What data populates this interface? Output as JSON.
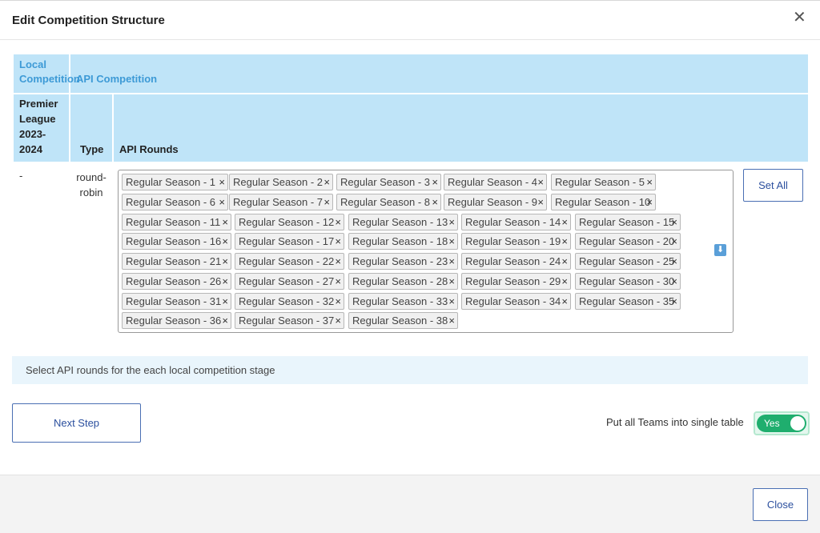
{
  "modal": {
    "title": "Edit Competition Structure"
  },
  "table": {
    "header_local": "Local Competition",
    "header_api": "API Competition",
    "sub_local": "Premier League 2023-2024",
    "sub_type": "Type",
    "sub_rounds": "API Rounds",
    "row": {
      "local": "-",
      "type": "round-robin"
    },
    "rounds": [
      "Regular Season - 1",
      "Regular Season - 2",
      "Regular Season - 3",
      "Regular Season - 4",
      "Regular Season - 5",
      "Regular Season - 6",
      "Regular Season - 7",
      "Regular Season - 8",
      "Regular Season - 9",
      "Regular Season - 10",
      "Regular Season - 11",
      "Regular Season - 12",
      "Regular Season - 13",
      "Regular Season - 14",
      "Regular Season - 15",
      "Regular Season - 16",
      "Regular Season - 17",
      "Regular Season - 18",
      "Regular Season - 19",
      "Regular Season - 20",
      "Regular Season - 21",
      "Regular Season - 22",
      "Regular Season - 23",
      "Regular Season - 24",
      "Regular Season - 25",
      "Regular Season - 26",
      "Regular Season - 27",
      "Regular Season - 28",
      "Regular Season - 29",
      "Regular Season - 30",
      "Regular Season - 31",
      "Regular Season - 32",
      "Regular Season - 33",
      "Regular Season - 34",
      "Regular Season - 35",
      "Regular Season - 36",
      "Regular Season - 37",
      "Regular Season - 38"
    ],
    "tag_remove_glyph": "×",
    "set_all_label": "Set All"
  },
  "info": {
    "text": "Select API rounds for the each local competition stage"
  },
  "actions": {
    "next_step": "Next Step",
    "toggle_label": "Put all Teams into single table",
    "toggle_value": "Yes",
    "close": "Close"
  },
  "icons": {
    "close": "close-icon",
    "dropdown": "dropdown-arrow-icon"
  },
  "colors": {
    "header_bg": "#bfe4f8",
    "header_text": "#3d9ad6",
    "accent": "#2b4f9e",
    "toggle_on": "#1fae6e"
  }
}
